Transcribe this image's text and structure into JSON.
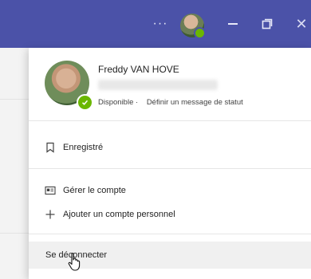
{
  "titlebar": {
    "more_label": "···",
    "close_label": "✕",
    "icons": {
      "more": "more-dots-icon",
      "minimize": "minimize-icon",
      "restore": "restore-window-icon",
      "close": "close-icon"
    },
    "color": "#4b52a8"
  },
  "profile": {
    "name": "Freddy VAN HOVE",
    "status": "Disponible ·",
    "set_status_label": "Définir un message de statut",
    "status_color": "#6bb700"
  },
  "menu": {
    "saved_label": "Enregistré",
    "manage_account_label": "Gérer le compte",
    "add_account_label": "Ajouter un compte personnel",
    "sign_out_label": "Se déconnecter"
  }
}
